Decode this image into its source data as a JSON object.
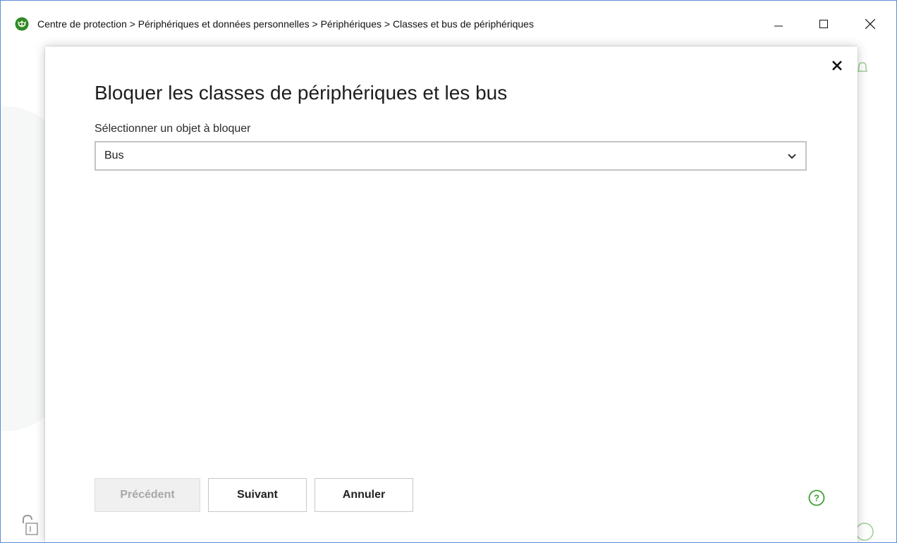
{
  "window": {
    "breadcrumb": "Centre de protection > Périphériques et données personnelles > Périphériques > Classes et bus de périphériques",
    "icons": {
      "app": "antivirus-cat-logo-icon",
      "minimize": "minimize-icon",
      "maximize": "maximize-icon",
      "close": "close-icon"
    }
  },
  "dialog": {
    "title": "Bloquer les classes de périphériques et les bus",
    "select_label": "Sélectionner un objet à bloquer",
    "select_value": "Bus",
    "buttons": {
      "previous": "Précédent",
      "next": "Suivant",
      "cancel": "Annuler"
    },
    "previous_enabled": false
  },
  "colors": {
    "accent_green": "#3fa232",
    "window_border": "#5b8fd6",
    "disabled_text": "#a8a8a8"
  }
}
